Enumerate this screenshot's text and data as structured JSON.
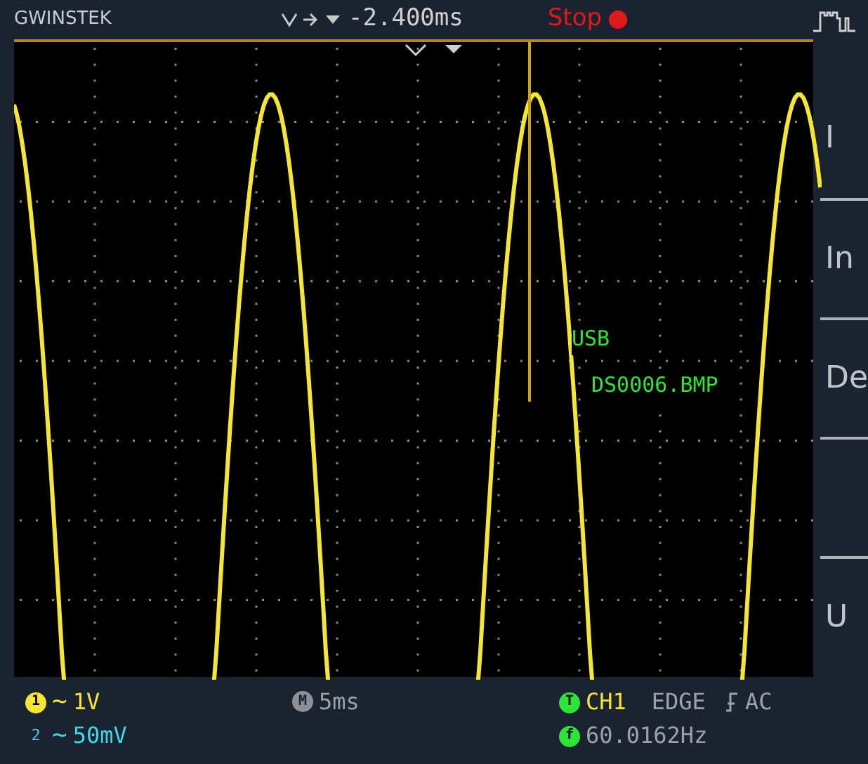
{
  "header": {
    "logo": "GWINSTEK",
    "trigger_position": "-2.400ms",
    "run_state": "Stop"
  },
  "screen": {
    "messages": [
      "USB",
      "DS0006.BMP"
    ]
  },
  "side_menu": {
    "items": [
      {
        "kind": "label",
        "label": "I"
      },
      {
        "kind": "label",
        "label": "In"
      },
      {
        "kind": "label",
        "label": "De"
      },
      {
        "kind": "blank"
      },
      {
        "kind": "label",
        "label": "U"
      }
    ]
  },
  "channels": [
    {
      "badge": "1",
      "coupling": "~",
      "scale": "1V",
      "color": "#f5e633"
    },
    {
      "badge": "2",
      "coupling": "~",
      "scale": "50mV",
      "color": "#3fd7e8"
    }
  ],
  "timebase": {
    "badge": "M",
    "value": "5ms"
  },
  "trigger": {
    "badge": "T",
    "source": "CH1",
    "type": "EDGE",
    "coupling": "AC"
  },
  "frequency": {
    "badge": "f",
    "value": "60.0162Hz"
  }
}
